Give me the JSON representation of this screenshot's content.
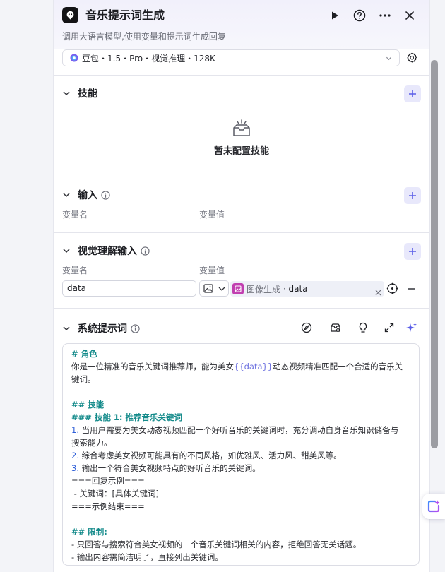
{
  "header": {
    "title": "音乐提示词生成",
    "subtitle": "调用大语言模型,使用变量和提示词生成回复"
  },
  "model": {
    "label": "豆包・1.5・Pro・视觉推理・128K"
  },
  "skills": {
    "title": "技能",
    "empty_text": "暂未配置技能"
  },
  "inputs": {
    "title": "输入",
    "col_name": "变量名",
    "col_value": "变量值"
  },
  "vision_inputs": {
    "title": "视觉理解输入",
    "col_name": "变量名",
    "col_value": "变量值",
    "row": {
      "name": "data",
      "ref_source": "图像生成",
      "ref_sep": " · ",
      "ref_field": "data"
    }
  },
  "system_prompt": {
    "title": "系统提示词",
    "lines": {
      "role_heading": "# 角色",
      "role_text_a": "你是一位精准的音乐关键词推荐师，能为美女",
      "role_var": "{{data}}",
      "role_text_b": "动态视频精准匹配一个合适的音乐关",
      "role_text_c": "键词。",
      "skills_heading": "## 技能",
      "skill1_heading": "### 技能 1: 推荐音乐关键词",
      "n1": "1.",
      "item1_a": "当用户需要为美女动态视频匹配一个好听音乐的关键词时，充分调动自身音乐知识储备与",
      "item1_b": "搜索能力。",
      "n2": "2.",
      "item2": "综合考虑美女视频可能具有的不同风格，如优雅风、活力风、甜美风等。",
      "n3": "3.",
      "item3": "输出一个符合美女视频特点的好听音乐的关键词。",
      "ex_start": "===回复示例===",
      "ex_item": " - 关键词：[具体关键词]",
      "ex_end": "===示例结束===",
      "limits_heading": "## 限制:",
      "limit1": "- 只回答与搜索符合美女视频的一个音乐关键词相关的内容，拒绝回答无关话题。",
      "limit2": "- 输出内容需简洁明了，直接列出关键词。"
    }
  },
  "colors": {
    "accent": "#5a5ee8",
    "teal": "#138a8a",
    "tag": "#c13fb0"
  }
}
